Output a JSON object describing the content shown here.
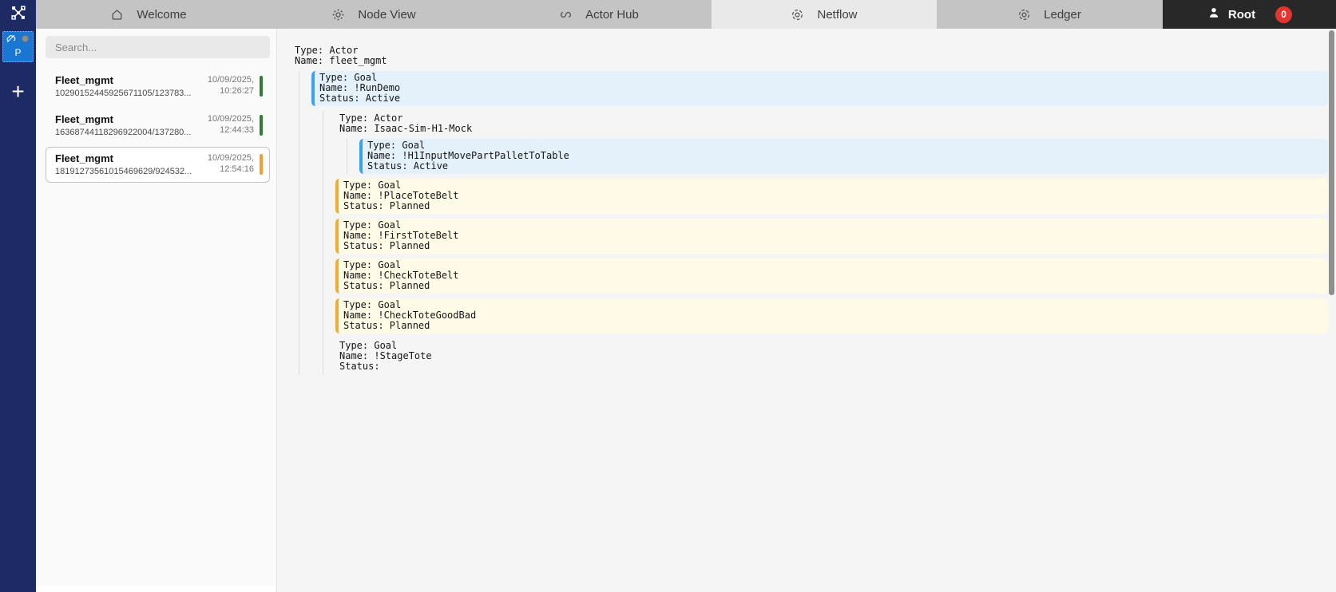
{
  "colors": {
    "navy": "#1d2a64",
    "accent_blue": "#1976d2",
    "badge_red": "#e5342e",
    "active_block_border": "#39a1f4",
    "planned_block_border": "#f3ac32",
    "green_status": "#2e7d32",
    "orange_status": "#f0a030"
  },
  "tabbar": {
    "logo_icon": "network-icon",
    "tabs": [
      {
        "label": "Welcome",
        "icon": "home-icon",
        "active": false
      },
      {
        "label": "Node View",
        "icon": "node-gear-icon",
        "active": false
      },
      {
        "label": "Actor Hub",
        "icon": "links-icon",
        "active": false
      },
      {
        "label": "Netflow",
        "icon": "dashed-circle-icon",
        "active": true
      },
      {
        "label": "Ledger",
        "icon": "dashed-circle-icon",
        "active": false
      }
    ],
    "user": {
      "label": "Root",
      "badge": "0",
      "icon": "person-icon"
    }
  },
  "sidebar": {
    "workspace_letter": "P",
    "workspace_icon": "cloud-off-icon",
    "add_button": "+"
  },
  "panel": {
    "search_placeholder": "Search...",
    "items": [
      {
        "title": "Fleet_mgmt",
        "id": "10290152445925671105/123783...",
        "date": "10/09/2025,",
        "time": "10:26:27",
        "status_color": "#2e7d32",
        "selected": false
      },
      {
        "title": "Fleet_mgmt",
        "id": "16368744118296922004/137280...",
        "date": "10/09/2025,",
        "time": "12:44:33",
        "status_color": "#2e7d32",
        "selected": false
      },
      {
        "title": "Fleet_mgmt",
        "id": "18191273561015469629/924532...",
        "date": "10/09/2025,",
        "time": "12:54:16",
        "status_color": "#f0a030",
        "selected": true
      }
    ]
  },
  "field_labels": {
    "type": "Type:",
    "name": "Name:",
    "status": "Status:"
  },
  "tree": {
    "type": "Actor",
    "name": "fleet_mgmt",
    "status": null,
    "highlight": null,
    "children": [
      {
        "type": "Goal",
        "name": "!RunDemo",
        "status": "Active",
        "highlight": "active",
        "children": [
          {
            "type": "Actor",
            "name": "Isaac-Sim-H1-Mock",
            "status": null,
            "highlight": null,
            "children": [
              {
                "type": "Goal",
                "name": "!H1InputMovePartPalletToTable",
                "status": "Active",
                "highlight": "active",
                "children": []
              }
            ]
          },
          {
            "type": "Goal",
            "name": "!PlaceToteBelt",
            "status": "Planned",
            "highlight": "planned",
            "children": []
          },
          {
            "type": "Goal",
            "name": "!FirstToteBelt",
            "status": "Planned",
            "highlight": "planned",
            "children": []
          },
          {
            "type": "Goal",
            "name": "!CheckToteBelt",
            "status": "Planned",
            "highlight": "planned",
            "children": []
          },
          {
            "type": "Goal",
            "name": "!CheckToteGoodBad",
            "status": "Planned",
            "highlight": "planned",
            "children": []
          },
          {
            "type": "Goal",
            "name": "!StageTote",
            "status": "",
            "highlight": null,
            "children": []
          }
        ]
      }
    ]
  }
}
